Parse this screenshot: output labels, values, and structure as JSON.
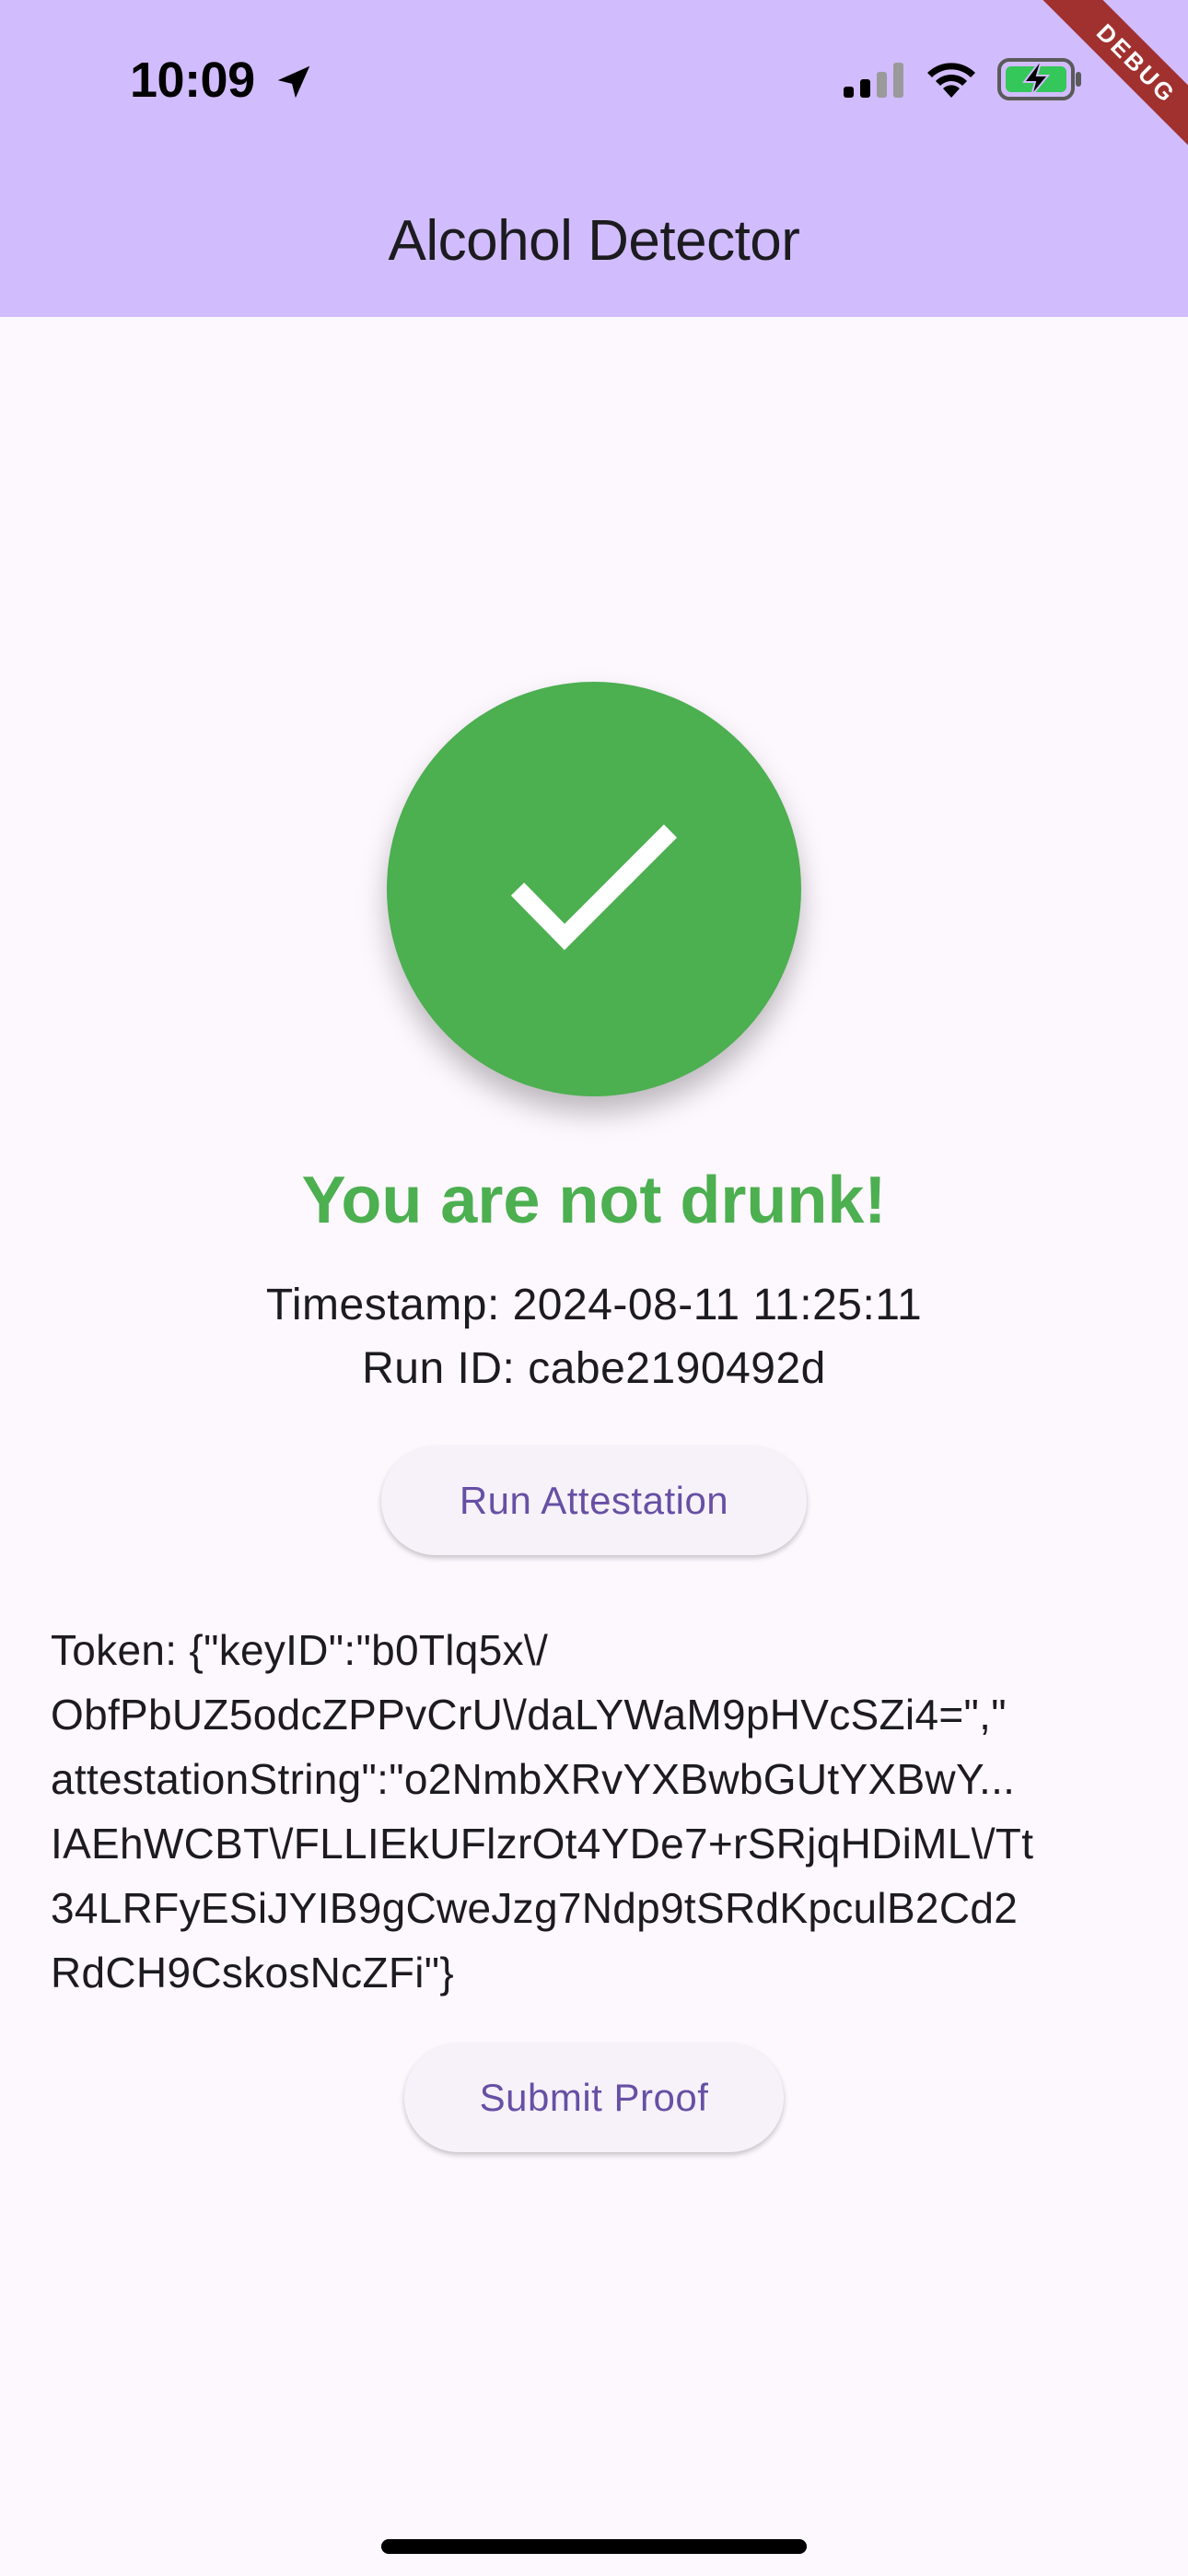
{
  "status_bar": {
    "time": "10:09"
  },
  "debug_banner": "DEBUG",
  "app_bar": {
    "title": "Alcohol Detector"
  },
  "result": {
    "icon": "check-icon",
    "message": "You are not drunk!",
    "timestamp": "Timestamp: 2024-08-11 11:25:11",
    "run_id": "Run ID: cabe2190492d"
  },
  "buttons": {
    "run_attestation": "Run Attestation",
    "submit_proof": "Submit Proof"
  },
  "token": {
    "text": "Token: {\"keyID\":\"b0Tlq5x\\/\nObfPbUZ5odcZPPvCrU\\/daLYWaM9pHVcSZi4=\",\"\nattestationString\":\"o2NmbXRvYXBwbGUtYXBwY...\nIAEhWCBT\\/FLLIEkUFlzrOt4YDe7+rSRjqHDiML\\/Tt\n34LRFyESiJYIB9gCweJzg7Ndp9tSRdKpculB2Cd2\nRdCH9CskosNcZFi\"}"
  },
  "colors": {
    "app_bar": "#d1bcfd",
    "background": "#fdf7fe",
    "success": "#4caf50",
    "button_text": "#6750a4",
    "debug_banner": "#a0312f"
  }
}
